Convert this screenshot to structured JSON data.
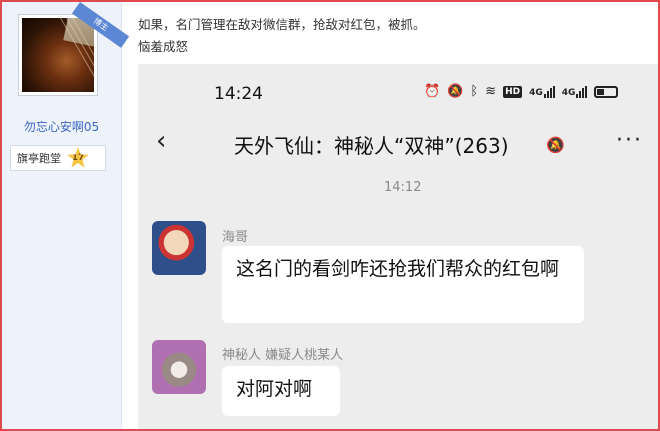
{
  "sidebar": {
    "username": "勿忘心安啊05",
    "badge": {
      "label": "旗亭跑堂",
      "level": "17"
    },
    "ribbon": "博主"
  },
  "post": {
    "line1": "如果，名门管理在敌对微信群，抢敌对红包，被抓。",
    "line2": "恼羞成怒"
  },
  "screenshot": {
    "status_bar": {
      "time": "14:24",
      "icons": [
        "alarm-icon",
        "mute-bell-icon",
        "bluetooth-icon",
        "wifi-icon",
        "hd-icon",
        "signal-4g-icon",
        "signal-4g-icon",
        "battery-icon"
      ],
      "hd_label": "HD",
      "signal1_label": "4G",
      "signal2_label": "4G"
    },
    "chat": {
      "back_icon": "back-arrow-icon",
      "title": "天外飞仙：神秘人“双神”(263)",
      "more_icon": "more-icon",
      "timestamp": "14:12",
      "messages": [
        {
          "sender": "海哥",
          "text": "这名门的看剑咋还抢我们帮众的红包啊"
        },
        {
          "sender": "神秘人 嫌疑人桃某人",
          "text": "对阿对啊"
        }
      ]
    }
  },
  "colors": {
    "accent_border": "#e04a4f",
    "username": "#3a66c4",
    "chat_bg": "#ededed"
  }
}
